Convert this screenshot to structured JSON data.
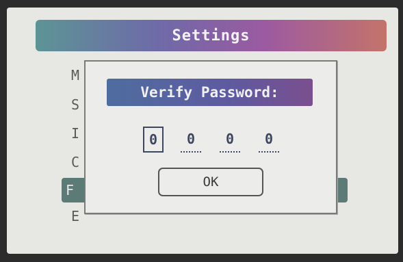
{
  "header": {
    "title": "Settings"
  },
  "menu": {
    "items": [
      {
        "label": "M"
      },
      {
        "label": "S"
      },
      {
        "label": "I"
      },
      {
        "label": "C"
      },
      {
        "label": "F"
      },
      {
        "label": "E"
      }
    ]
  },
  "dialog": {
    "title": "Verify Password:",
    "digits": [
      "0",
      "0",
      "0",
      "0"
    ],
    "ok_label": "OK"
  }
}
